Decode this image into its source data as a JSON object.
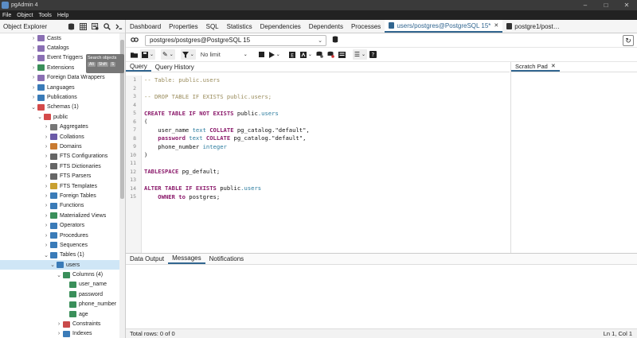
{
  "window": {
    "title": "pgAdmin 4",
    "min": "–",
    "max": "□",
    "close": "✕"
  },
  "menu": [
    "File",
    "Object",
    "Tools",
    "Help"
  ],
  "object_explorer": {
    "title": "Object Explorer",
    "tooltip": {
      "text": "Search objects",
      "keys": [
        "Alt",
        "Shift",
        "S"
      ]
    },
    "tree": [
      {
        "label": "Casts",
        "depth": 3,
        "chev": "›",
        "color": "#8a6fb3"
      },
      {
        "label": "Catalogs",
        "depth": 3,
        "chev": "›",
        "color": "#8a6fb3"
      },
      {
        "label": "Event Triggers",
        "depth": 3,
        "chev": "›",
        "color": "#8a6fb3"
      },
      {
        "label": "Extensions",
        "depth": 3,
        "chev": "›",
        "color": "#3a8f5a"
      },
      {
        "label": "Foreign Data Wrappers",
        "depth": 3,
        "chev": "›",
        "color": "#8a6fb3"
      },
      {
        "label": "Languages",
        "depth": 3,
        "chev": "›",
        "color": "#3a7bb8"
      },
      {
        "label": "Publications",
        "depth": 3,
        "chev": "›",
        "color": "#3a7bb8"
      },
      {
        "label": "Schemas (1)",
        "depth": 3,
        "chev": "⌄",
        "color": "#d44a4a"
      },
      {
        "label": "public",
        "depth": 4,
        "chev": "⌄",
        "color": "#d44a4a"
      },
      {
        "label": "Aggregates",
        "depth": 5,
        "chev": "›",
        "color": "#777777"
      },
      {
        "label": "Collations",
        "depth": 5,
        "chev": "›",
        "color": "#6b5aa8"
      },
      {
        "label": "Domains",
        "depth": 5,
        "chev": "›",
        "color": "#c97a30"
      },
      {
        "label": "FTS Configurations",
        "depth": 5,
        "chev": "›",
        "color": "#666666"
      },
      {
        "label": "FTS Dictionaries",
        "depth": 5,
        "chev": "›",
        "color": "#666666"
      },
      {
        "label": "FTS Parsers",
        "depth": 5,
        "chev": "›",
        "color": "#666666"
      },
      {
        "label": "FTS Templates",
        "depth": 5,
        "chev": "›",
        "color": "#c9a030"
      },
      {
        "label": "Foreign Tables",
        "depth": 5,
        "chev": "›",
        "color": "#3a7bb8"
      },
      {
        "label": "Functions",
        "depth": 5,
        "chev": "›",
        "color": "#3a7bb8"
      },
      {
        "label": "Materialized Views",
        "depth": 5,
        "chev": "›",
        "color": "#3a8f5a"
      },
      {
        "label": "Operators",
        "depth": 5,
        "chev": "›",
        "color": "#3a7bb8"
      },
      {
        "label": "Procedures",
        "depth": 5,
        "chev": "›",
        "color": "#3a7bb8"
      },
      {
        "label": "Sequences",
        "depth": 5,
        "chev": "›",
        "color": "#3a7bb8"
      },
      {
        "label": "Tables (1)",
        "depth": 5,
        "chev": "⌄",
        "color": "#3a7bb8"
      },
      {
        "label": "users",
        "depth": 6,
        "chev": "⌄",
        "color": "#3a7bb8",
        "selected": true
      },
      {
        "label": "Columns (4)",
        "depth": 7,
        "chev": "⌄",
        "color": "#3a8f5a"
      },
      {
        "label": "user_name",
        "depth": 8,
        "chev": "",
        "color": "#3a8f5a"
      },
      {
        "label": "password",
        "depth": 8,
        "chev": "",
        "color": "#3a8f5a"
      },
      {
        "label": "phone_number",
        "depth": 8,
        "chev": "",
        "color": "#3a8f5a"
      },
      {
        "label": "age",
        "depth": 8,
        "chev": "",
        "color": "#3a8f5a"
      },
      {
        "label": "Constraints",
        "depth": 7,
        "chev": "›",
        "color": "#c94a4a"
      },
      {
        "label": "Indexes",
        "depth": 7,
        "chev": "›",
        "color": "#3a7bb8"
      }
    ]
  },
  "tabs": [
    {
      "label": "Dashboard"
    },
    {
      "label": "Properties"
    },
    {
      "label": "SQL"
    },
    {
      "label": "Statistics"
    },
    {
      "label": "Dependencies"
    },
    {
      "label": "Dependents"
    },
    {
      "label": "Processes"
    },
    {
      "label": "users/postgres@PostgreSQL 15*",
      "active": true,
      "closable": true
    },
    {
      "label": "postgre1/post…",
      "closable": false
    }
  ],
  "connection": {
    "value": "postgres/postgres@PostgreSQL 15"
  },
  "toolbar": {
    "limit": "No limit"
  },
  "query_tabs": [
    "Query",
    "Query History"
  ],
  "scratch_pad": {
    "label": "Scratch Pad"
  },
  "editor_lines": [
    [
      [
        "cm",
        "-- Table: public.users"
      ]
    ],
    [],
    [
      [
        "cm",
        "-- DROP TABLE IF EXISTS public.users;"
      ]
    ],
    [],
    [
      [
        "kw",
        "CREATE TABLE IF NOT EXISTS "
      ],
      [
        "id",
        "public"
      ],
      [
        "ty",
        ".users"
      ]
    ],
    [
      [
        "id",
        "("
      ]
    ],
    [
      [
        "id",
        "    user_name "
      ],
      [
        "ty",
        "text "
      ],
      [
        "kw",
        "COLLATE "
      ],
      [
        "id",
        "pg_catalog.\"default\","
      ]
    ],
    [
      [
        "kw",
        "    password "
      ],
      [
        "ty",
        "text "
      ],
      [
        "kw",
        "COLLATE "
      ],
      [
        "id",
        "pg_catalog.\"default\","
      ]
    ],
    [
      [
        "id",
        "    phone_number "
      ],
      [
        "ty",
        "integer"
      ]
    ],
    [
      [
        "id",
        ")"
      ]
    ],
    [],
    [
      [
        "kw",
        "TABLESPACE "
      ],
      [
        "id",
        "pg_default;"
      ]
    ],
    [],
    [
      [
        "kw",
        "ALTER TABLE IF EXISTS "
      ],
      [
        "id",
        "public"
      ],
      [
        "ty",
        ".users"
      ]
    ],
    [
      [
        "kw",
        "    OWNER to "
      ],
      [
        "id",
        "postgres;"
      ]
    ]
  ],
  "bottom_tabs": [
    {
      "label": "Data Output"
    },
    {
      "label": "Messages",
      "active": true
    },
    {
      "label": "Notifications"
    }
  ],
  "status": {
    "rows": "Total rows: 0 of 0",
    "position": "Ln 1, Col 1"
  }
}
